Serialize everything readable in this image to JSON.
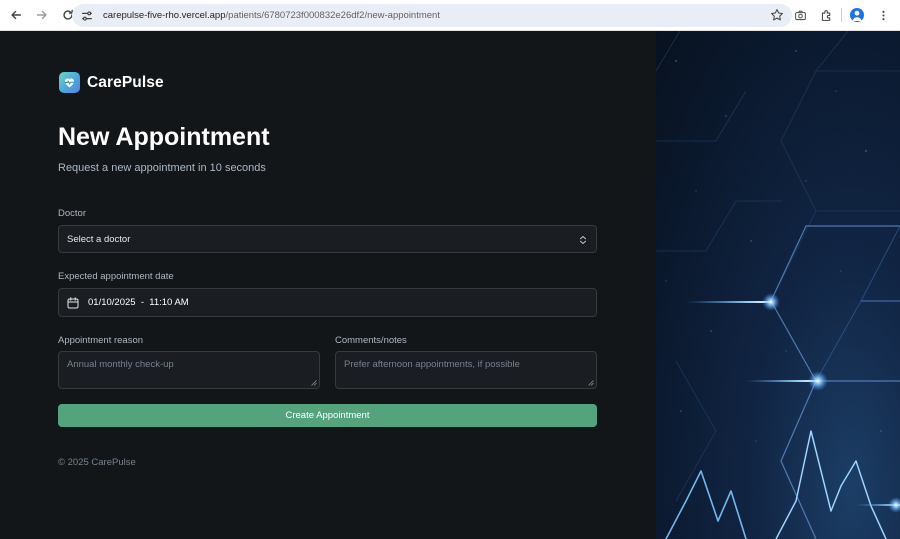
{
  "browser": {
    "url_host": "carepulse-five-rho.vercel.app",
    "url_path": "/patients/6780723f000832e26df2/new-appointment",
    "back_icon": "back-arrow-icon",
    "forward_icon": "forward-arrow-icon",
    "reload_icon": "reload-icon",
    "site_info_icon": "tune-icon",
    "bookmark_icon": "star-icon",
    "extra_icons": [
      "camera-icon",
      "extensions-icon",
      "profile-icon",
      "more-vert-icon"
    ]
  },
  "brand": {
    "name": "CarePulse",
    "logo_icon": "carepulse-logo-icon",
    "accent_color": "#54a37c"
  },
  "header": {
    "title": "New Appointment",
    "subtitle": "Request a new appointment in 10 seconds"
  },
  "form": {
    "doctor": {
      "label": "Doctor",
      "value": "Select a doctor"
    },
    "date": {
      "label": "Expected appointment date",
      "value": "01/10/2025  -  11:10 AM"
    },
    "reason": {
      "label": "Appointment reason",
      "placeholder": "Annual monthly check-up"
    },
    "notes": {
      "label": "Comments/notes",
      "placeholder": "Prefer afternoon appointments, if possible"
    },
    "submit_label": "Create Appointment"
  },
  "footer": {
    "copyright": "© 2025 CarePulse"
  },
  "colors": {
    "background": "#131619",
    "field_background": "#1a1d21",
    "field_border": "#363a3d",
    "muted_text": "#abb8c4"
  }
}
